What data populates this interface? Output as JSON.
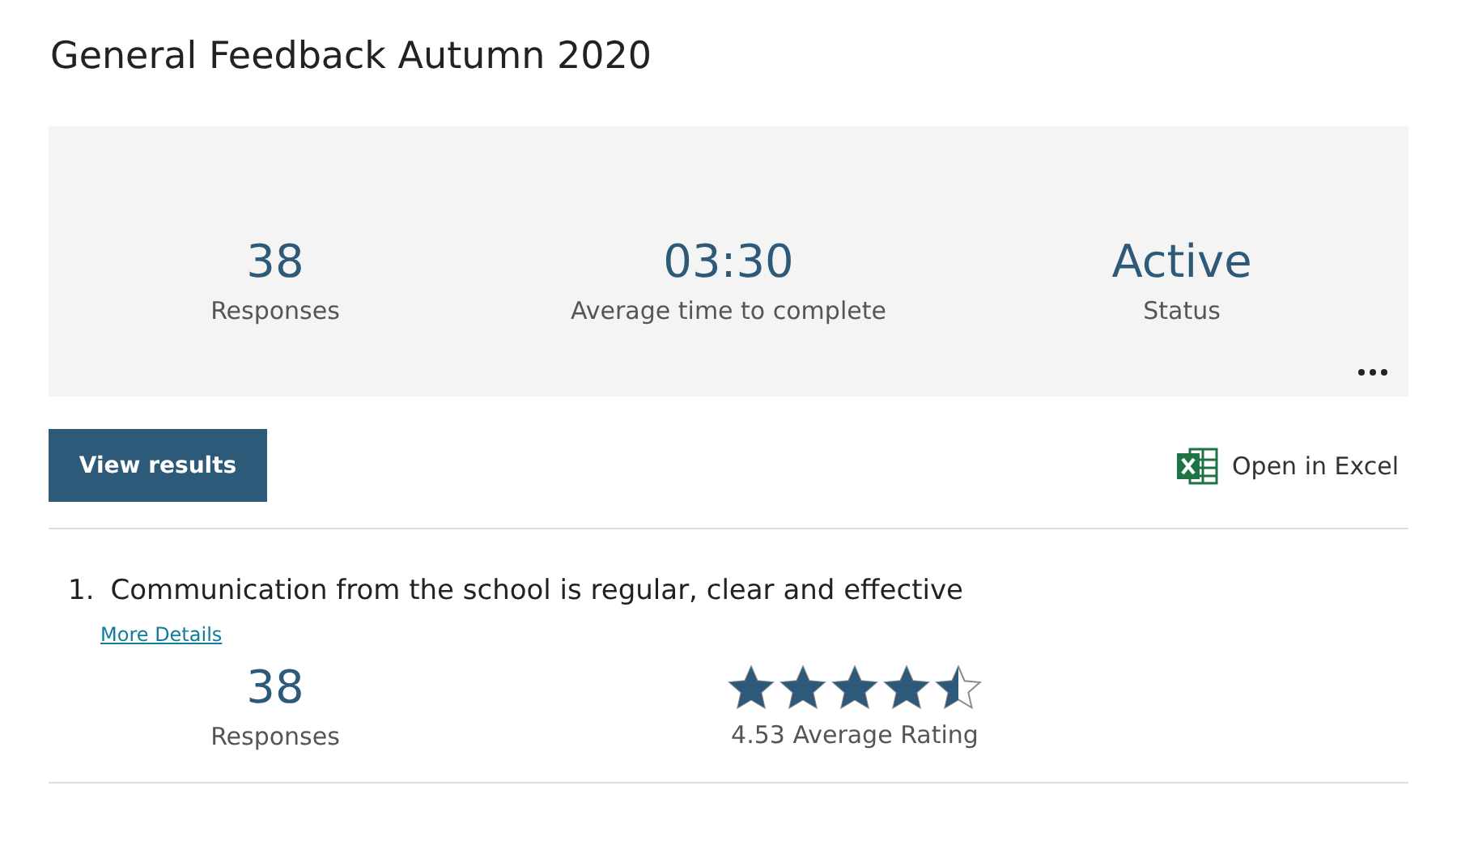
{
  "title": "General Feedback Autumn 2020",
  "summary": [
    {
      "value": "38",
      "label": "Responses"
    },
    {
      "value": "03:30",
      "label": "Average time to complete"
    },
    {
      "value": "Active",
      "label": "Status"
    }
  ],
  "actions": {
    "view_button": "View results",
    "excel_link": "Open in Excel"
  },
  "questions": [
    {
      "number": "1.",
      "text": "Communication from the school is regular, clear and effective",
      "link": "More Details",
      "responses": "38",
      "responses_label": "Responses",
      "stars": 4.5,
      "rating": "4.53 Average Rating"
    }
  ]
}
